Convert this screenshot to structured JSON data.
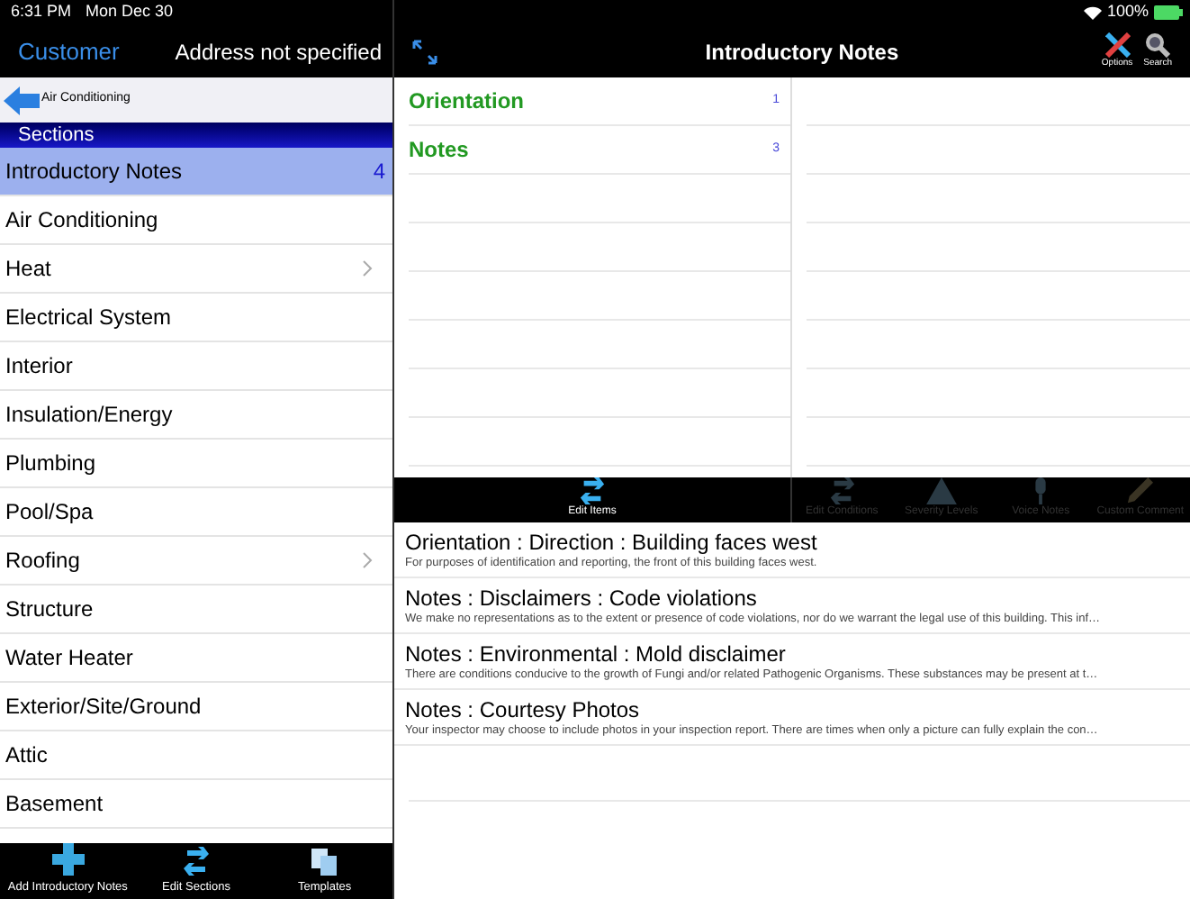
{
  "status_bar": {
    "time": "6:31 PM",
    "date": "Mon Dec 30",
    "battery": "100%"
  },
  "left_nav": {
    "back_button": "Customer",
    "address": "Address not specified"
  },
  "breadcrumb": {
    "label": "Air Conditioning"
  },
  "sections": {
    "header": "Sections",
    "items": [
      {
        "label": "Introductory Notes",
        "count": "4",
        "selected": true,
        "expandable": false
      },
      {
        "label": "Air Conditioning",
        "selected": false,
        "expandable": false
      },
      {
        "label": "Heat",
        "selected": false,
        "expandable": true
      },
      {
        "label": "Electrical System",
        "selected": false,
        "expandable": false
      },
      {
        "label": "Interior",
        "selected": false,
        "expandable": false
      },
      {
        "label": "Insulation/Energy",
        "selected": false,
        "expandable": false
      },
      {
        "label": "Plumbing",
        "selected": false,
        "expandable": false
      },
      {
        "label": "Pool/Spa",
        "selected": false,
        "expandable": false
      },
      {
        "label": "Roofing",
        "selected": false,
        "expandable": true
      },
      {
        "label": "Structure",
        "selected": false,
        "expandable": false
      },
      {
        "label": "Water Heater",
        "selected": false,
        "expandable": false
      },
      {
        "label": "Exterior/Site/Ground",
        "selected": false,
        "expandable": false
      },
      {
        "label": "Attic",
        "selected": false,
        "expandable": false
      },
      {
        "label": "Basement",
        "selected": false,
        "expandable": false
      }
    ]
  },
  "left_toolbar": [
    {
      "kind": "add",
      "label": "Add Introductory Notes"
    },
    {
      "kind": "edit",
      "label": "Edit Sections"
    },
    {
      "kind": "templates",
      "label": "Templates"
    }
  ],
  "main_nav": {
    "title": "Introductory Notes",
    "actions": [
      {
        "kind": "options",
        "label": "Options"
      },
      {
        "kind": "search",
        "label": "Search"
      }
    ]
  },
  "categories": [
    {
      "label": "Orientation",
      "count": "1"
    },
    {
      "label": "Notes",
      "count": "3"
    }
  ],
  "item_toolbar": [
    {
      "kind": "edit",
      "label": "Edit Items",
      "disabled": false
    },
    {
      "kind": "edit",
      "label": "Edit Conditions",
      "disabled": true
    },
    {
      "kind": "warning",
      "label": "Severity Levels",
      "disabled": true
    },
    {
      "kind": "mic",
      "label": "Voice Notes",
      "disabled": true
    },
    {
      "kind": "pencil",
      "label": "Custom Comment",
      "disabled": true
    }
  ],
  "notes": [
    {
      "title": "Orientation : Direction : Building faces west",
      "text": "For purposes of identification and reporting, the front of this building faces west."
    },
    {
      "title": "Notes : Disclaimers : Code violations",
      "text": "We make no representations as to the extent or presence of code violations, nor do we warrant the legal use of this building. This inf…"
    },
    {
      "title": "Notes : Environmental : Mold disclaimer",
      "text": "There are conditions conducive to the growth of Fungi and/or related Pathogenic Organisms. These substances may be present at t…"
    },
    {
      "title": "Notes : Courtesy Photos",
      "text": "Your inspector may choose to include photos in your inspection report. There are times when only a picture can fully explain the con…"
    }
  ]
}
